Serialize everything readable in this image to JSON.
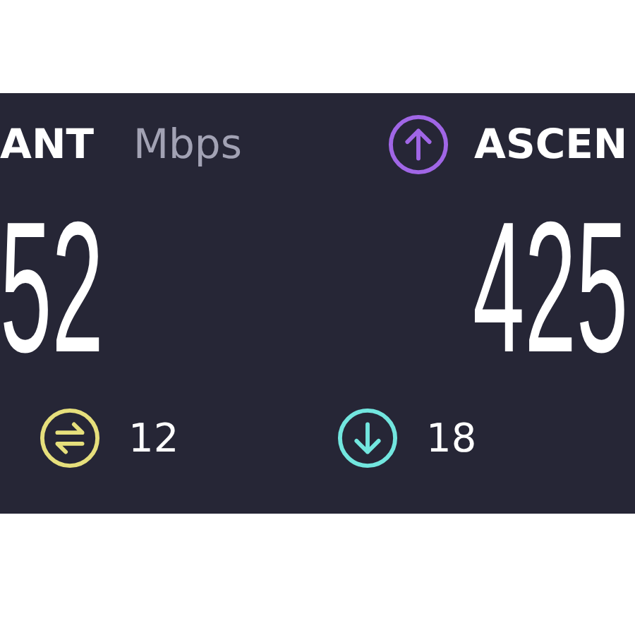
{
  "download": {
    "label": "ANT",
    "unit": "Mbps",
    "value": "52"
  },
  "upload": {
    "label": "ASCEN",
    "value": "425"
  },
  "stats": [
    {
      "kind": "jitter",
      "value": "12",
      "color": "#e6df7c"
    },
    {
      "kind": "download",
      "value": "18",
      "color": "#72e6df"
    }
  ]
}
